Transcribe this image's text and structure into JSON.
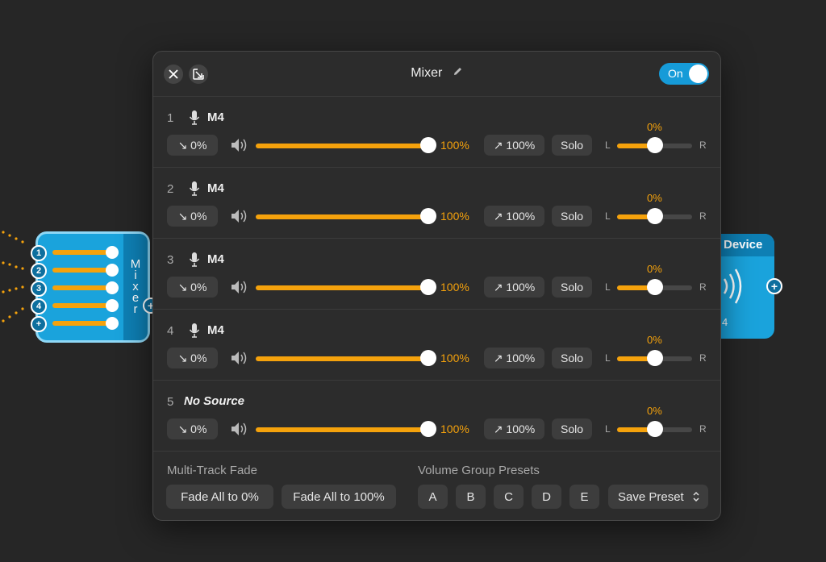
{
  "canvas": {
    "mixer_node": {
      "side_label": [
        "M",
        "i",
        "x",
        "e",
        "r"
      ],
      "inputs": [
        "1",
        "2",
        "3",
        "4",
        "+"
      ],
      "output_port": "+"
    },
    "device_node": {
      "title": "Device",
      "number": "4",
      "output_port": "+"
    }
  },
  "panel": {
    "title": "Mixer",
    "toggle_label": "On",
    "tracks": [
      {
        "num": "1",
        "name": "M4",
        "fade_in": "↘ 0%",
        "volume": "100%",
        "volume_level": 1.0,
        "fade_out": "↗ 100%",
        "solo": "Solo",
        "pan_L": "L",
        "pan_R": "R",
        "pan_value": "0%",
        "pan_level": 0.5
      },
      {
        "num": "2",
        "name": "M4",
        "fade_in": "↘ 0%",
        "volume": "100%",
        "volume_level": 1.0,
        "fade_out": "↗ 100%",
        "solo": "Solo",
        "pan_L": "L",
        "pan_R": "R",
        "pan_value": "0%",
        "pan_level": 0.5
      },
      {
        "num": "3",
        "name": "M4",
        "fade_in": "↘ 0%",
        "volume": "100%",
        "volume_level": 1.0,
        "fade_out": "↗ 100%",
        "solo": "Solo",
        "pan_L": "L",
        "pan_R": "R",
        "pan_value": "0%",
        "pan_level": 0.5
      },
      {
        "num": "4",
        "name": "M4",
        "fade_in": "↘ 0%",
        "volume": "100%",
        "volume_level": 1.0,
        "fade_out": "↗ 100%",
        "solo": "Solo",
        "pan_L": "L",
        "pan_R": "R",
        "pan_value": "0%",
        "pan_level": 0.5
      },
      {
        "num": "5",
        "name": "No Source",
        "fade_in": "↘ 0%",
        "volume": "100%",
        "volume_level": 1.0,
        "fade_out": "↗ 100%",
        "solo": "Solo",
        "pan_L": "L",
        "pan_R": "R",
        "pan_value": "0%",
        "pan_level": 0.5
      }
    ],
    "footer": {
      "fade_label": "Multi-Track Fade",
      "fade_all_0": "Fade All to 0%",
      "fade_all_100": "Fade All to 100%",
      "presets_label": "Volume Group Presets",
      "presets": [
        "A",
        "B",
        "C",
        "D",
        "E"
      ],
      "save_preset": "Save Preset"
    }
  },
  "colors": {
    "accent": "#f5a20c",
    "toggle": "#169bd8",
    "node": "#1aa3dc"
  }
}
